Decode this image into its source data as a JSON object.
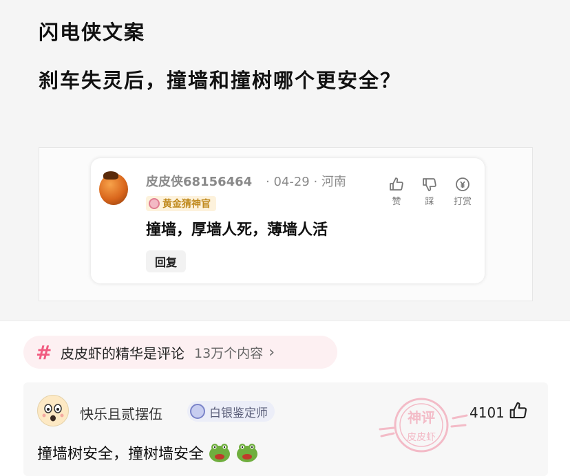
{
  "post": {
    "title": "闪电侠文案",
    "question": "刹车失灵后，撞墙和撞树哪个更安全？"
  },
  "screenshot_comment": {
    "username": "皮皮侠68156464",
    "meta": "· 04-29 · 河南",
    "badge": "黄金猜神官",
    "text": "撞墙，厚墙人死，薄墙人活",
    "reply_label": "回复",
    "actions": [
      {
        "label": "赞",
        "icon": "thumbs-up-icon"
      },
      {
        "label": "踩",
        "icon": "thumbs-down-icon"
      },
      {
        "label": "打赏",
        "icon": "tip-coin-icon"
      }
    ]
  },
  "topic": {
    "hash": "#",
    "name": "皮皮虾的精华是评论",
    "count": "13万个内容",
    "chevron": "›"
  },
  "hot_comment": {
    "username": "快乐且贰摆伍",
    "badge": "白银鉴定师",
    "stamp_top": "神评",
    "stamp_bottom": "皮皮虾",
    "likes": "4101",
    "text": "撞墙树安全，撞树墙安全",
    "emoji_icon": "frog-emoji-icon",
    "colors": {
      "accent_pink": "#f15b80",
      "stamp": "#f4b7c1"
    }
  }
}
